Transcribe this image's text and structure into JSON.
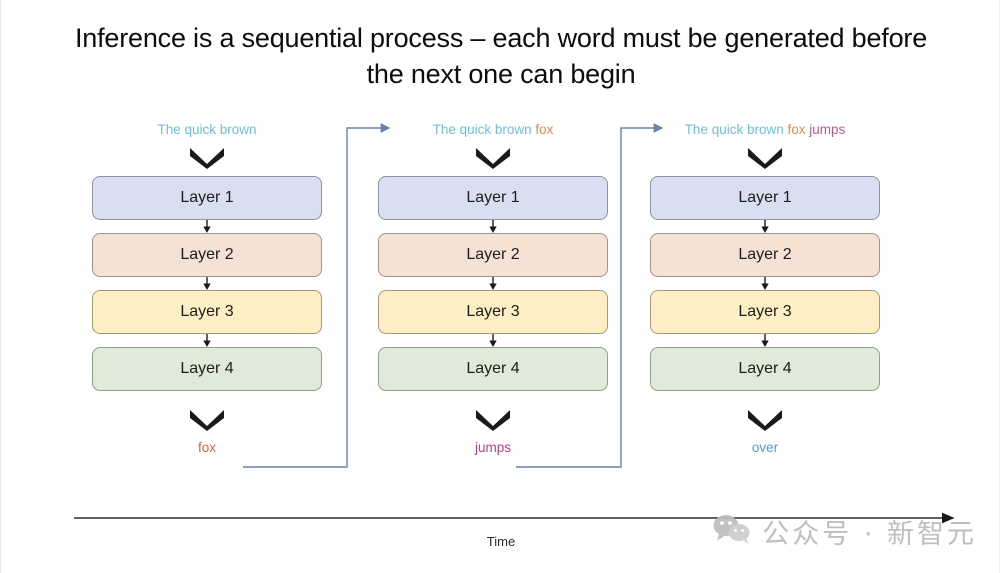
{
  "slide": {
    "title_line_1": "Inference is a sequential process – each word must be generated before",
    "title_line_2": "the next one can begin",
    "background_color": "#ffffff"
  },
  "palette": {
    "prompt_base": "#6fbfd8",
    "word_fox": "#e08a5a",
    "word_jumps": "#c0559b",
    "word_over": "#4a9ed8",
    "layer_1": "#d9dff0",
    "layer_2": "#f6e2d5",
    "layer_3": "#fdeec4",
    "layer_4": "#dfead9",
    "connector": "#6b82ab",
    "axis": "#2b2b2b"
  },
  "columns": [
    {
      "prompt_tokens": [
        {
          "text": "The quick brown",
          "style": "base"
        }
      ],
      "input_chevron": "chevron-down-icon",
      "layers": [
        {
          "label": "Layer 1"
        },
        {
          "label": "Layer 2"
        },
        {
          "label": "Layer 3"
        },
        {
          "label": "Layer 4"
        }
      ],
      "output_chevron": "chevron-down-icon",
      "output_word": "fox",
      "output_style": "fox"
    },
    {
      "prompt_tokens": [
        {
          "text": "The quick brown",
          "style": "base"
        },
        {
          "text": "fox",
          "style": "fox"
        }
      ],
      "input_chevron": "chevron-down-icon",
      "layers": [
        {
          "label": "Layer 1"
        },
        {
          "label": "Layer 2"
        },
        {
          "label": "Layer 3"
        },
        {
          "label": "Layer 4"
        }
      ],
      "output_chevron": "chevron-down-icon",
      "output_word": "jumps",
      "output_style": "jumps"
    },
    {
      "prompt_tokens": [
        {
          "text": "The quick brown",
          "style": "base"
        },
        {
          "text": "fox",
          "style": "fox"
        },
        {
          "text": "jumps",
          "style": "jumps"
        }
      ],
      "input_chevron": "chevron-down-icon",
      "layers": [
        {
          "label": "Layer 1"
        },
        {
          "label": "Layer 2"
        },
        {
          "label": "Layer 3"
        },
        {
          "label": "Layer 4"
        }
      ],
      "output_chevron": "chevron-down-icon",
      "output_word": "over",
      "output_style": "over"
    }
  ],
  "connectors": [
    {
      "from_output": "fox",
      "to_column_prompt": "The quick brown fox"
    },
    {
      "from_output": "jumps",
      "to_column_prompt": "The quick brown fox jumps"
    }
  ],
  "axis": {
    "label": "Time",
    "arrow_direction": "right"
  },
  "watermark": {
    "icon": "wechat-icon",
    "text": "公众号 · 新智元"
  }
}
